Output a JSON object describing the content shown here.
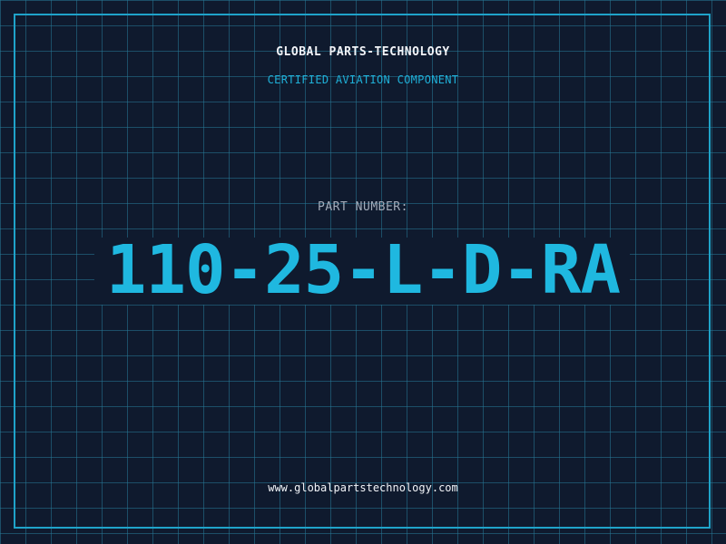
{
  "header": {
    "company_name": "GLOBAL PARTS-TECHNOLOGY",
    "subtitle": "CERTIFIED AVIATION COMPONENT"
  },
  "part": {
    "label": "PART NUMBER:",
    "number": "110-25-L-D-RA"
  },
  "footer": {
    "website": "www.globalpartstechnology.com"
  },
  "colors": {
    "background": "#0f1a2e",
    "grid": "#26789a",
    "accent": "#1fb8e0",
    "frame": "#1fa3c9",
    "label_gray": "#a4adbb",
    "text_white": "#f2f4f8"
  }
}
